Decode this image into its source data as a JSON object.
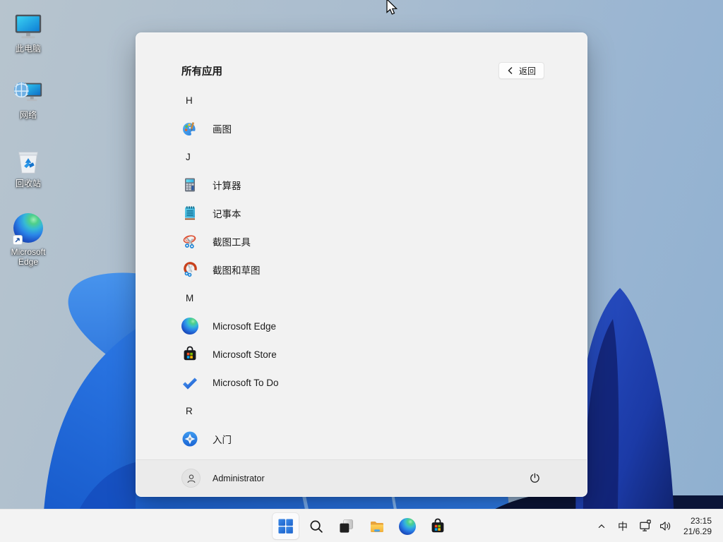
{
  "colors": {
    "accent": "#1764d8",
    "menu_bg": "#f2f2f2",
    "userbar_bg": "#ebebeb",
    "taskbar_bg": "#f3f3f3",
    "text": "#1b1b1b",
    "bloom_blue": "#2e7be8",
    "bloom_navy": "#1b3aa6"
  },
  "desktop": {
    "icons": [
      {
        "label": "此电脑",
        "icon": "this-pc-icon"
      },
      {
        "label": "网络",
        "icon": "network-icon"
      },
      {
        "label": "回收站",
        "icon": "recycle-bin-icon"
      },
      {
        "label": "Microsoft Edge",
        "icon": "edge-icon"
      }
    ]
  },
  "start_menu": {
    "title": "所有应用",
    "back_button": {
      "label": "返回",
      "icon": "chevron-left-icon"
    },
    "items": [
      {
        "type": "section",
        "label": "H"
      },
      {
        "type": "app",
        "label": "画图",
        "icon": "paint-icon"
      },
      {
        "type": "section",
        "label": "J"
      },
      {
        "type": "app",
        "label": "计算器",
        "icon": "calculator-icon"
      },
      {
        "type": "app",
        "label": "记事本",
        "icon": "notepad-icon"
      },
      {
        "type": "app",
        "label": "截图工具",
        "icon": "snipping-tool-icon"
      },
      {
        "type": "app",
        "label": "截图和草图",
        "icon": "snip-sketch-icon"
      },
      {
        "type": "section",
        "label": "M"
      },
      {
        "type": "app",
        "label": "Microsoft Edge",
        "icon": "edge-icon"
      },
      {
        "type": "app",
        "label": "Microsoft Store",
        "icon": "store-icon"
      },
      {
        "type": "app",
        "label": "Microsoft To Do",
        "icon": "todo-icon"
      },
      {
        "type": "section",
        "label": "R"
      },
      {
        "type": "app",
        "label": "入门",
        "icon": "get-started-icon"
      }
    ],
    "user": {
      "name": "Administrator",
      "power_icon": "power-icon"
    }
  },
  "taskbar": {
    "buttons": [
      {
        "name": "start",
        "icon": "windows-logo-icon",
        "active": true
      },
      {
        "name": "search",
        "icon": "search-icon"
      },
      {
        "name": "task-view",
        "icon": "task-view-icon"
      },
      {
        "name": "file-explorer",
        "icon": "folder-icon"
      },
      {
        "name": "edge",
        "icon": "edge-icon"
      },
      {
        "name": "store",
        "icon": "store-icon"
      }
    ],
    "tray": {
      "ime_label": "中",
      "time": "23:15",
      "date": "21/6.29"
    }
  }
}
